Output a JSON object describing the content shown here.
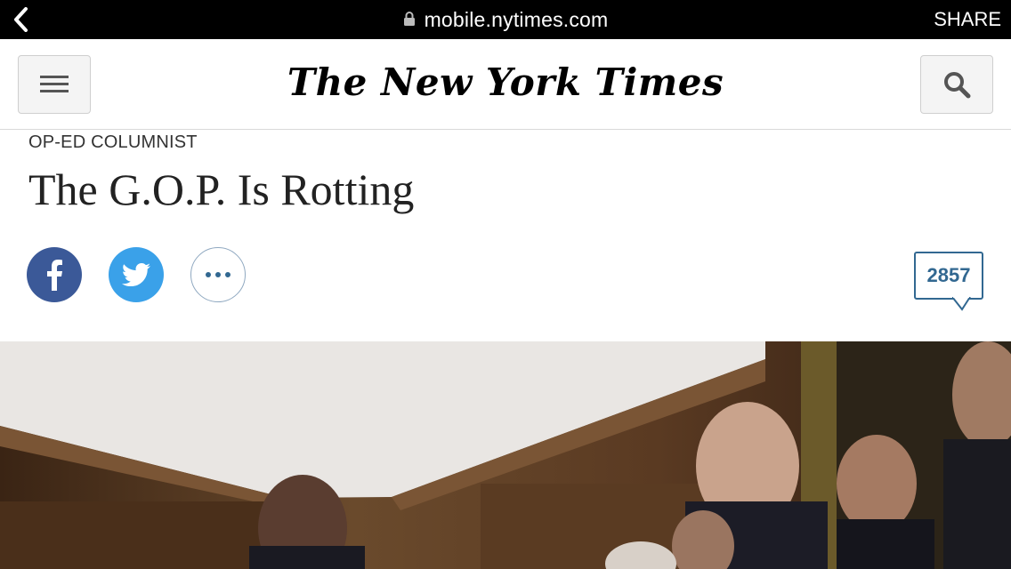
{
  "browser": {
    "url": "mobile.nytimes.com",
    "share_label": "SHARE"
  },
  "header": {
    "logo_text": "The New York Times"
  },
  "article": {
    "kicker": "OP-ED COLUMNIST",
    "headline": "The G.O.P. Is Rotting",
    "comment_count": "2857"
  },
  "icons": {
    "back": "chevron-left-icon",
    "lock": "lock-icon",
    "menu": "hamburger-menu-icon",
    "search": "search-icon",
    "facebook": "facebook-icon",
    "twitter": "twitter-icon",
    "more": "more-icon"
  },
  "colors": {
    "facebook": "#3b5998",
    "twitter": "#3aa1e9",
    "comments_accent": "#326891"
  }
}
